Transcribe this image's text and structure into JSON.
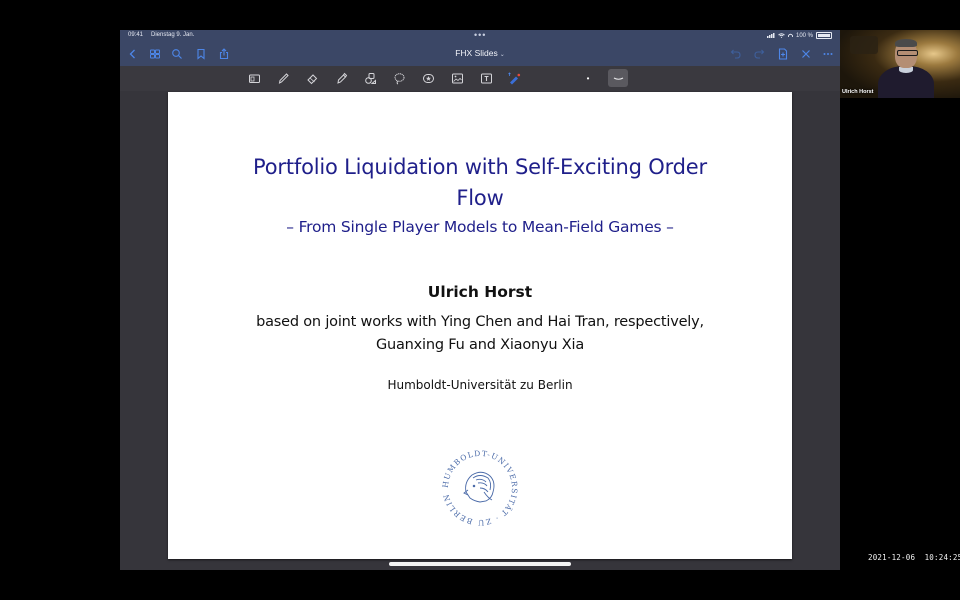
{
  "status_bar": {
    "time": "09:41",
    "date": "Dienstag 9. Jan.",
    "multitask_dots": "•••",
    "battery_label": "100 %",
    "battery_level_percent": 100
  },
  "nav_bar": {
    "document_title": "FHX Slides",
    "title_chevron": "⌄",
    "left_icons": [
      "back-icon",
      "grid-icon",
      "search-icon",
      "bookmark-icon",
      "share-icon"
    ],
    "right_icons": [
      "undo-icon",
      "redo-icon",
      "add-page-icon",
      "close-icon",
      "more-icon"
    ]
  },
  "toolbar": {
    "tools": [
      "view-mode",
      "pen",
      "eraser",
      "highlighter",
      "shapes",
      "lasso",
      "sticker",
      "image",
      "text",
      "laser-pointer"
    ],
    "pen_size_dot": "•",
    "selected_stroke": "⌣"
  },
  "slide": {
    "title_line1": "Portfolio Liquidation with Self-Exciting Order",
    "title_line2": "Flow",
    "subtitle": "– From Single Player Models to Mean-Field Games –",
    "author": "Ulrich Horst",
    "joint_line1": "based on joint works with Ying Chen and Hai Tran, respectively,",
    "joint_line2": "Guanxing Fu and Xiaonyu Xia",
    "institution": "Humboldt-Universität zu Berlin",
    "seal_text": "HUMBOLDT-UNIVERSITÄT · ZU BERLIN ·",
    "title_color": "#1f1f8a"
  },
  "video": {
    "participant_name": "Ulrich Horst"
  },
  "recording_timestamp": "2021-12-06  10:24:25",
  "colors": {
    "ipad_bar": "#3b4766",
    "accent_blue": "#4d86e8",
    "toolbar_bg": "#3a393f",
    "canvas_bg": "#36353b"
  }
}
